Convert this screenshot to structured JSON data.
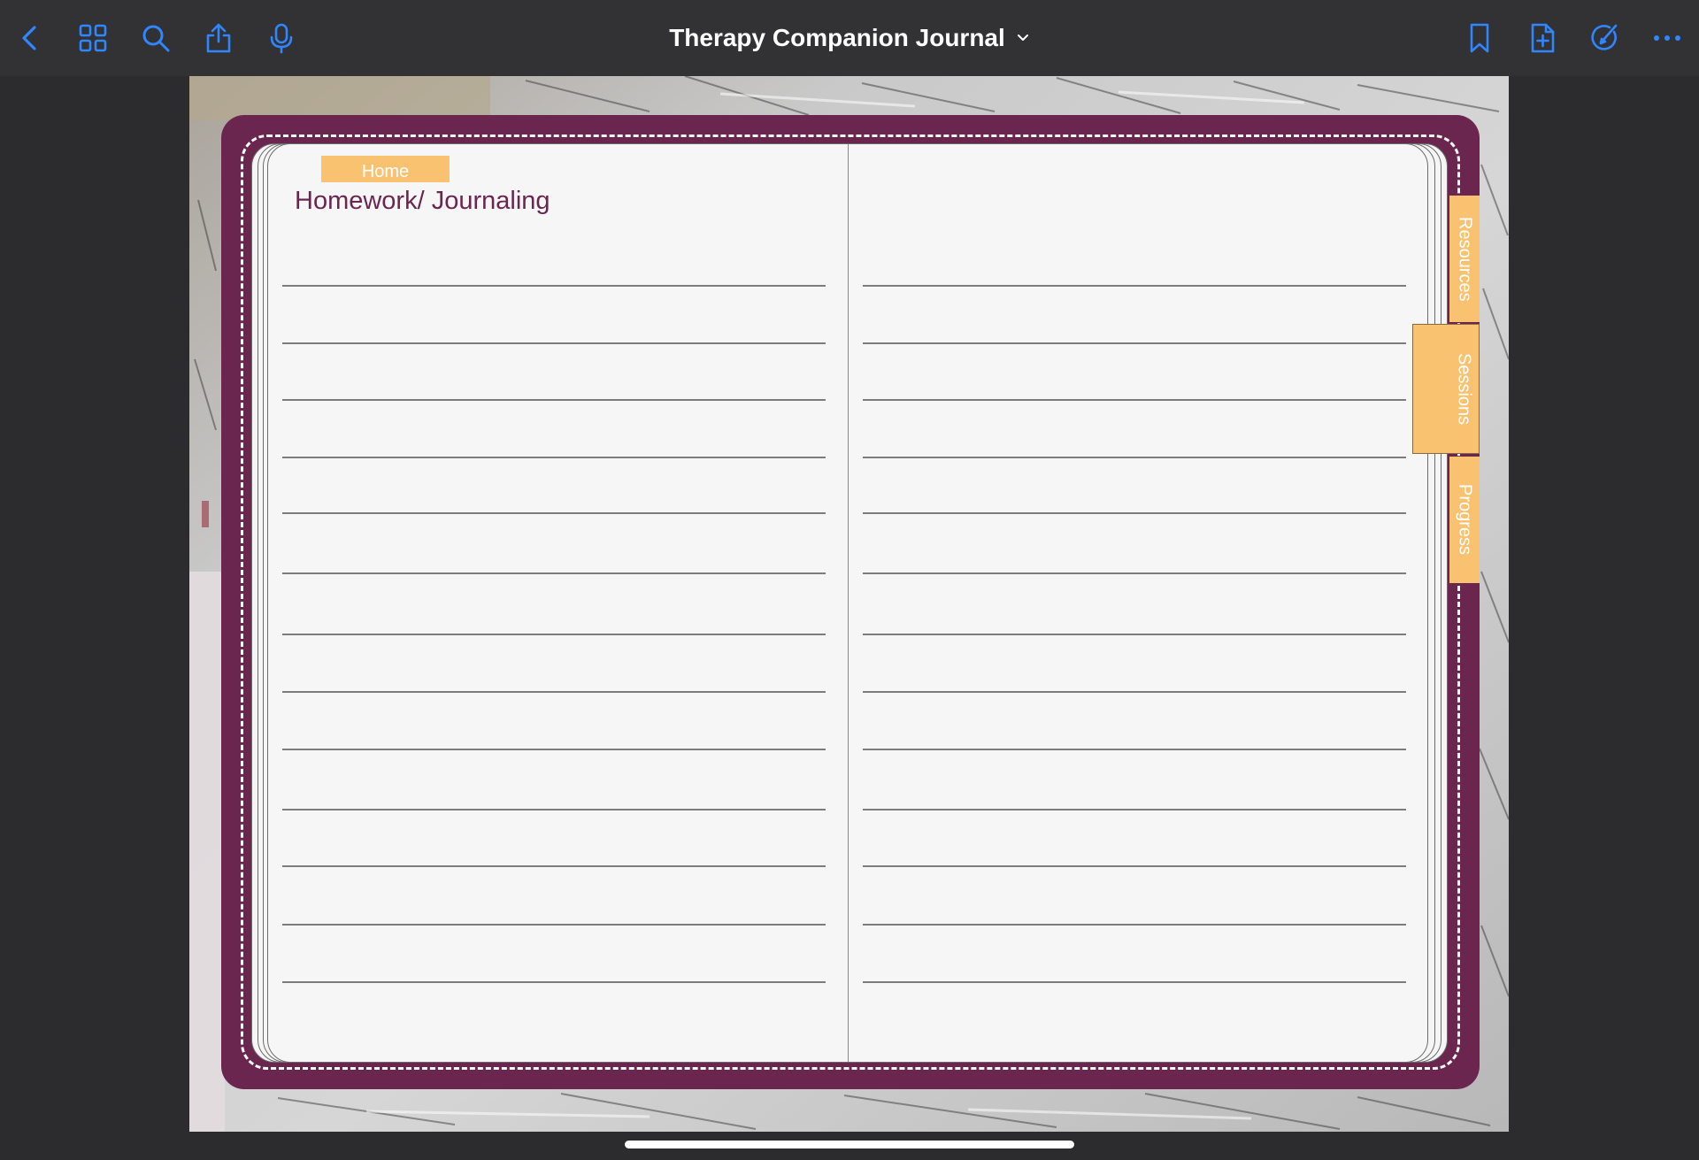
{
  "toolbar": {
    "title": "Therapy Companion Journal",
    "accent_color": "#2f86ff",
    "left_icons": [
      "back-chevron-icon",
      "thumbnails-grid-icon",
      "search-icon",
      "share-icon",
      "microphone-icon"
    ],
    "right_icons": [
      "bookmark-icon",
      "add-page-icon",
      "pen-edit-icon",
      "more-icon"
    ],
    "title_dropdown_icon": "chevron-down-icon"
  },
  "planner": {
    "cover_color": "#6b2650",
    "tab_color": "#f9c271",
    "home_tab": "Home",
    "side_tabs": [
      "Resources",
      "Sessions",
      "Progress"
    ],
    "active_side_tab": "Sessions",
    "left_page_heading": "Homework/ Journaling"
  }
}
